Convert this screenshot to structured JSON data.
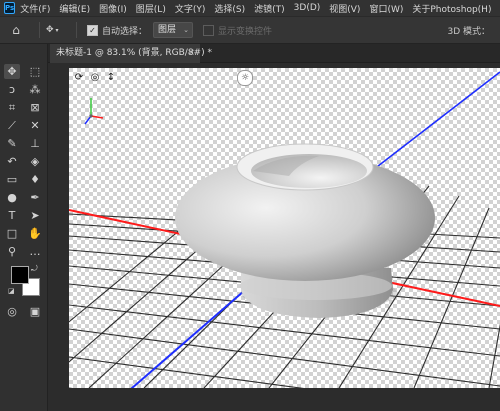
{
  "app": {
    "logo_text": "Ps"
  },
  "menubar": {
    "items": [
      "文件(F)",
      "编辑(E)",
      "图像(I)",
      "图层(L)",
      "文字(Y)",
      "选择(S)",
      "滤镜(T)",
      "3D(D)",
      "视图(V)",
      "窗口(W)",
      "关于Photoshop(H)"
    ]
  },
  "optionsbar": {
    "auto_select_label": "自动选择：",
    "auto_select_checked": true,
    "layer_select_value": "图层",
    "show_transform_label": "显示变换控件",
    "mode_label": "3D 模式："
  },
  "document": {
    "tab_title": "未标题-1 @ 83.1% (背景, RGB/8#) *",
    "close_glyph": "×"
  },
  "tools": [
    {
      "name": "move-tool-icon",
      "glyph": "✥"
    },
    {
      "name": "marquee-tool-icon",
      "glyph": "⬚"
    },
    {
      "name": "lasso-tool-icon",
      "glyph": "ↄ"
    },
    {
      "name": "magic-wand-tool-icon",
      "glyph": "⁂"
    },
    {
      "name": "crop-tool-icon",
      "glyph": "⌗"
    },
    {
      "name": "frame-tool-icon",
      "glyph": "⊠"
    },
    {
      "name": "eyedropper-tool-icon",
      "glyph": "⟋"
    },
    {
      "name": "healing-brush-tool-icon",
      "glyph": "✕"
    },
    {
      "name": "brush-tool-icon",
      "glyph": "✎"
    },
    {
      "name": "clone-stamp-tool-icon",
      "glyph": "⊥"
    },
    {
      "name": "history-brush-tool-icon",
      "glyph": "↶"
    },
    {
      "name": "eraser-tool-icon",
      "glyph": "◈"
    },
    {
      "name": "gradient-tool-icon",
      "glyph": "▭"
    },
    {
      "name": "blur-tool-icon",
      "glyph": "♦"
    },
    {
      "name": "dodge-tool-icon",
      "glyph": "●"
    },
    {
      "name": "pen-tool-icon",
      "glyph": "✒"
    },
    {
      "name": "type-tool-icon",
      "glyph": "T"
    },
    {
      "name": "path-selection-tool-icon",
      "glyph": "➤"
    },
    {
      "name": "rectangle-tool-icon",
      "glyph": "□"
    },
    {
      "name": "hand-tool-icon",
      "glyph": "✋"
    },
    {
      "name": "zoom-tool-icon",
      "glyph": "⚲"
    },
    {
      "name": "more-tools-icon",
      "glyph": "…"
    },
    {
      "name": "quick-mask-icon",
      "glyph": "◎"
    },
    {
      "name": "screen-mode-icon",
      "glyph": "▣"
    }
  ],
  "colors": {
    "foreground": "#000000",
    "background": "#ffffff",
    "x_axis": "#ff1a1a",
    "z_axis": "#1e2eff",
    "y_axis": "#39c93c"
  },
  "scene": {
    "object": "3D vase / mushroom-shaped mesh",
    "axis_widget_labels": [
      "y",
      "x",
      "z"
    ]
  }
}
